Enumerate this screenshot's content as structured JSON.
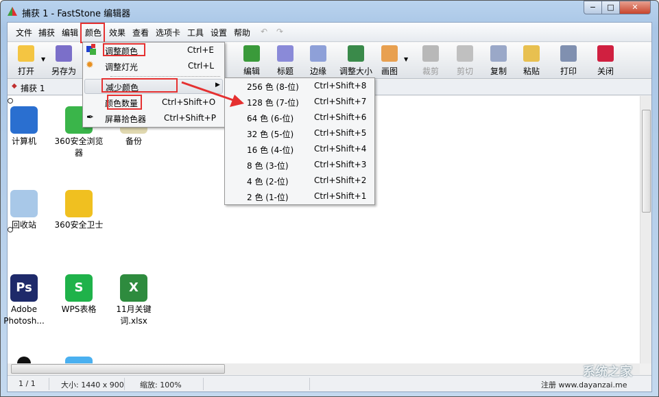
{
  "window": {
    "title": "捕获 1 - FastStone 编辑器",
    "min": "−",
    "max": "□",
    "close": "✕"
  },
  "menubar": [
    "文件",
    "捕获",
    "编辑",
    "颜色",
    "效果",
    "查看",
    "选项卡",
    "工具",
    "设置",
    "帮助"
  ],
  "undo": "↶",
  "redo": "↷",
  "toolbar": [
    {
      "label": "打开",
      "icon": "folder-open-icon",
      "color": "#f4c542"
    },
    {
      "label": "另存为",
      "icon": "save-icon",
      "color": "#7b6fc9"
    },
    {
      "label": "编辑",
      "icon": "edit-palette-icon",
      "color": "#3a9a3a"
    },
    {
      "label": "标题",
      "icon": "caption-icon",
      "color": "#8a8ad8"
    },
    {
      "label": "边缘",
      "icon": "edge-icon",
      "color": "#8ea0d8"
    },
    {
      "label": "调整大小",
      "icon": "resize-icon",
      "color": "#3a8a4a"
    },
    {
      "label": "画图",
      "icon": "paint-icon",
      "color": "#e8a050"
    },
    {
      "label": "裁剪",
      "icon": "crop-icon",
      "color": "#b8b8b8",
      "disabled": true
    },
    {
      "label": "剪切",
      "icon": "scissors-icon",
      "color": "#c0c0c0",
      "disabled": true
    },
    {
      "label": "复制",
      "icon": "copy-icon",
      "color": "#9aa8c8"
    },
    {
      "label": "粘贴",
      "icon": "paste-icon",
      "color": "#e8c050"
    },
    {
      "label": "打印",
      "icon": "printer-icon",
      "color": "#8090b0"
    },
    {
      "label": "关闭",
      "icon": "power-icon",
      "color": "#d02040"
    }
  ],
  "tab": {
    "label": "捕获 1"
  },
  "color_menu": [
    {
      "label": "调整颜色",
      "shortcut": "Ctrl+E",
      "icon": "adjust-color-icon"
    },
    {
      "label": "调整灯光",
      "shortcut": "Ctrl+L",
      "icon": "sun-icon"
    },
    {
      "label": "减少颜色",
      "shortcut": "",
      "submenu": true
    },
    {
      "label": "颜色数量",
      "shortcut": "Ctrl+Shift+O"
    },
    {
      "label": "屏幕拾色器",
      "shortcut": "Ctrl+Shift+P",
      "icon": "eyedropper-icon"
    }
  ],
  "submenu": [
    {
      "label": "256 色 (8-位)",
      "shortcut": "Ctrl+Shift+8"
    },
    {
      "label": "128 色 (7-位)",
      "shortcut": "Ctrl+Shift+7"
    },
    {
      "label": "64 色 (6-位)",
      "shortcut": "Ctrl+Shift+6"
    },
    {
      "label": "32 色 (5-位)",
      "shortcut": "Ctrl+Shift+5"
    },
    {
      "label": "16 色 (4-位)",
      "shortcut": "Ctrl+Shift+4"
    },
    {
      "label": "8 色 (3-位)",
      "shortcut": "Ctrl+Shift+3"
    },
    {
      "label": "4 色 (2-位)",
      "shortcut": "Ctrl+Shift+2"
    },
    {
      "label": "2 色 (1-位)",
      "shortcut": "Ctrl+Shift+1"
    }
  ],
  "desktop": [
    {
      "label": "计算机",
      "color": "#2a6fd0"
    },
    {
      "label": "360安全浏览器",
      "color": "#3ab54a"
    },
    {
      "label": "备份",
      "color": "#e0d8b0"
    },
    {
      "label": "回收站",
      "color": "#a8c8e8"
    },
    {
      "label": "360安全卫士",
      "color": "#f0c020"
    },
    {
      "label": "Adobe Photosh...",
      "color": "#1e2a6a",
      "glyph": "Ps"
    },
    {
      "label": "WPS表格",
      "color": "#1fb24a",
      "glyph": "S"
    },
    {
      "label": "11月关键词.xlsx",
      "color": "#2e8b3e",
      "glyph": "X"
    }
  ],
  "status": {
    "page": "1 / 1",
    "size": "大小: 1440 x 900",
    "zoom": "缩放: 100%",
    "register": "注册 www.dayanzai.me"
  },
  "watermark": "系统之家"
}
